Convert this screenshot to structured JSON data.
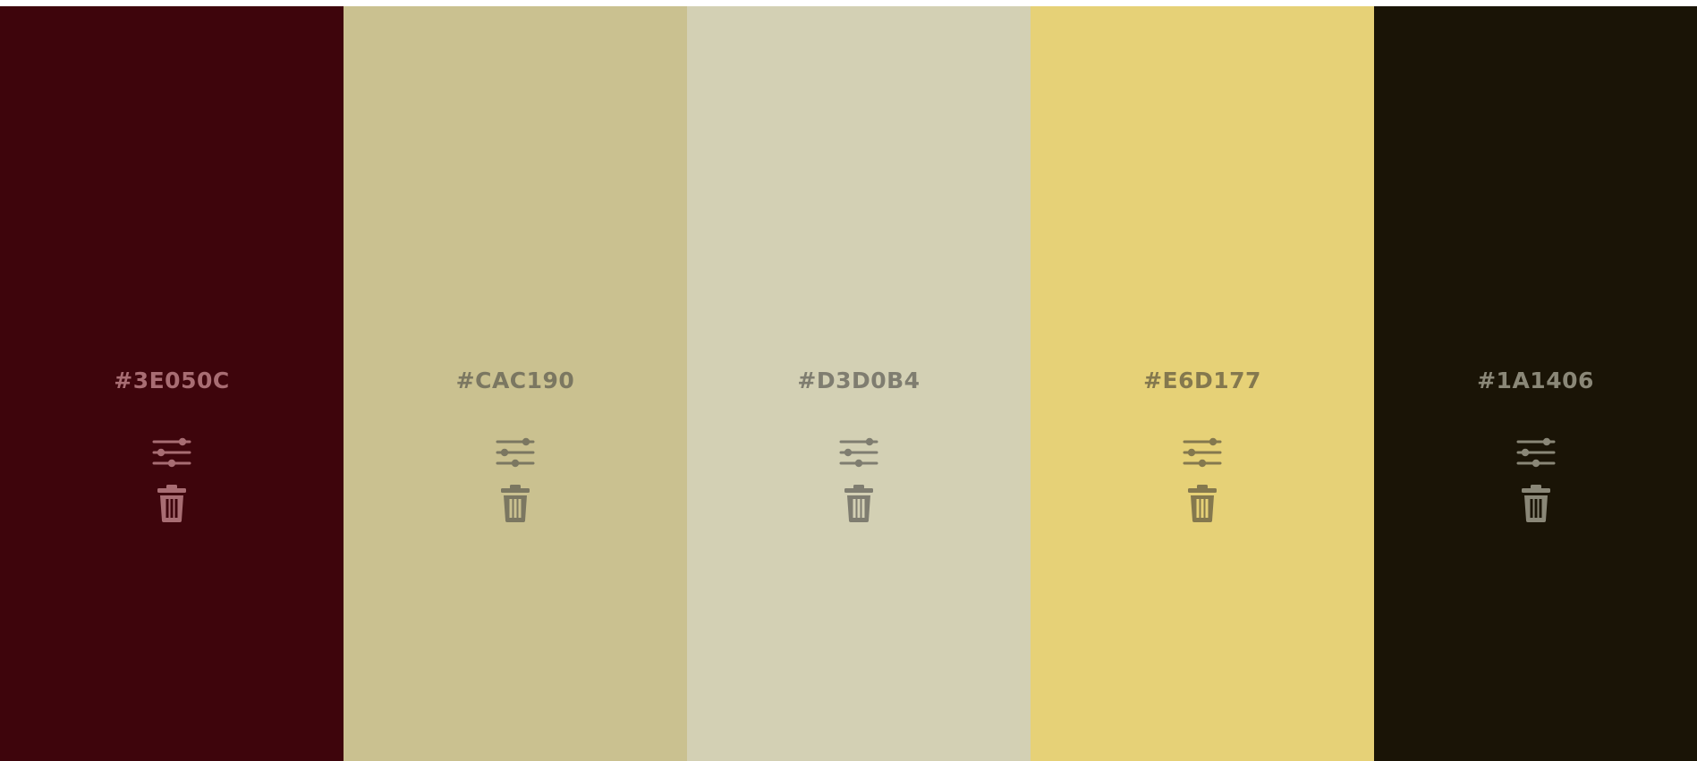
{
  "swatches": [
    {
      "hex": "#3E050C",
      "color": "#3E050C",
      "fg": "#A86D73"
    },
    {
      "hex": "#CAC190",
      "color": "#CAC190",
      "fg": "#7B7761"
    },
    {
      "hex": "#D3D0B4",
      "color": "#D3D0B4",
      "fg": "#7F7D70"
    },
    {
      "hex": "#E6D177",
      "color": "#E6D177",
      "fg": "#84784E"
    },
    {
      "hex": "#1A1406",
      "color": "#1A1406",
      "fg": "#8A8777"
    }
  ],
  "icons": {
    "adjust": "sliders-icon",
    "delete": "trash-icon"
  }
}
